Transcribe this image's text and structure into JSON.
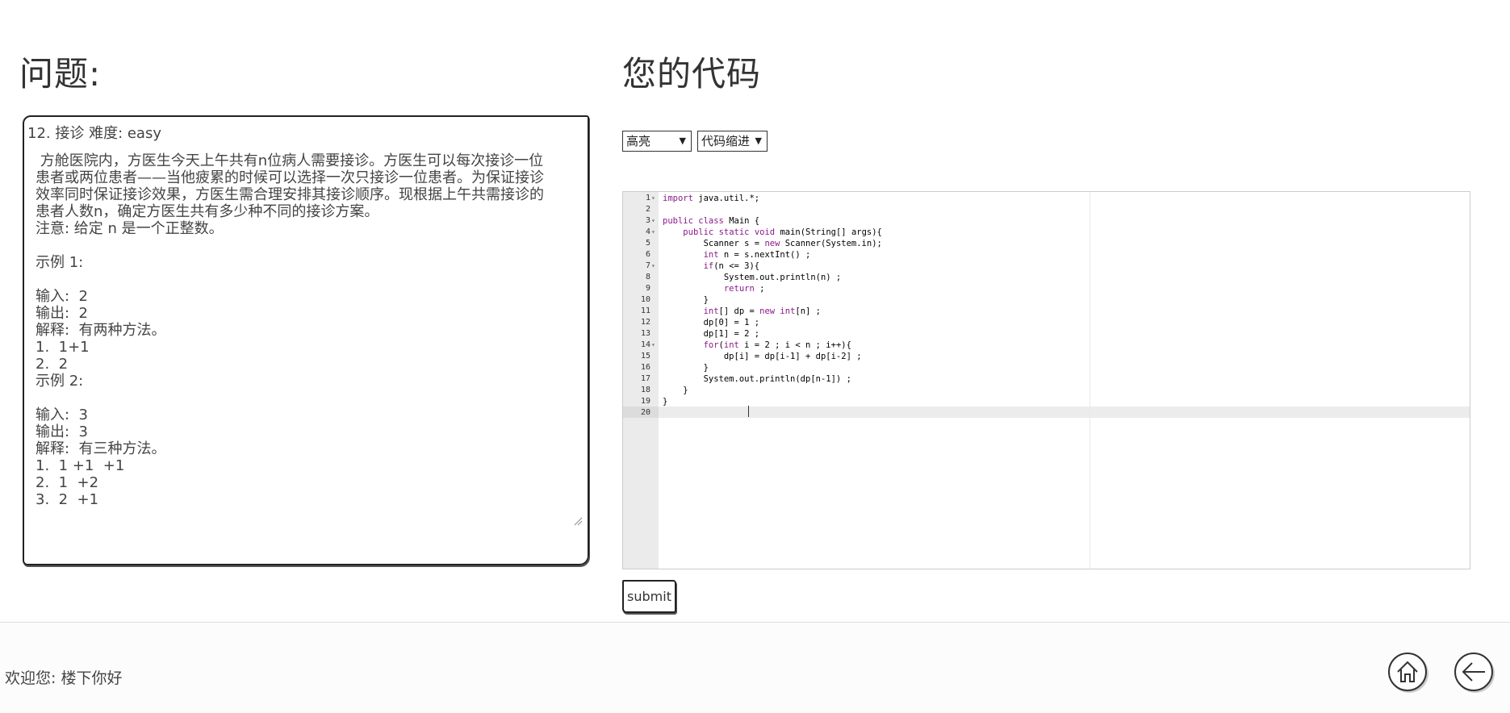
{
  "headings": {
    "question": "问题:",
    "code": "您的代码"
  },
  "problem": {
    "title": "12. 接诊 难度: easy",
    "body": " 方舱医院内，方医生今天上午共有n位病人需要接诊。方医生可以每次接诊一位\n患者或两位患者——当他疲累的时候可以选择一次只接诊一位患者。为保证接诊\n效率同时保证接诊效果，方医生需合理安排其接诊顺序。现根据上午共需接诊的\n患者人数n，确定方医生共有多少种不同的接诊方案。\n注意: 给定 n 是一个正整数。\n\n示例 1:\n\n输入:  2\n输出:  2\n解释:  有两种方法。\n1.  1+1\n2.  2\n示例 2:\n\n输入:  3\n输出:  3\n解释:  有三种方法。\n1.  1 +1  +1\n2.  1  +2\n3.  2  +1"
  },
  "toolbar": {
    "highlight_select": "高亮",
    "indent_select": "代码缩进"
  },
  "editor": {
    "lines": [
      {
        "n": "1",
        "fold": "▾",
        "code": "import java.util.*;"
      },
      {
        "n": "2",
        "fold": "",
        "code": ""
      },
      {
        "n": "3",
        "fold": "▾",
        "code": "public class Main {"
      },
      {
        "n": "4",
        "fold": "▾",
        "code": "    public static void main(String[] args){"
      },
      {
        "n": "5",
        "fold": "",
        "code": "        Scanner s = new Scanner(System.in);"
      },
      {
        "n": "6",
        "fold": "",
        "code": "        int n = s.nextInt() ;"
      },
      {
        "n": "7",
        "fold": "▾",
        "code": "        if(n <= 3){"
      },
      {
        "n": "8",
        "fold": "",
        "code": "            System.out.println(n) ;"
      },
      {
        "n": "9",
        "fold": "",
        "code": "            return ;"
      },
      {
        "n": "10",
        "fold": "",
        "code": "        }"
      },
      {
        "n": "11",
        "fold": "",
        "code": "        int[] dp = new int[n] ;"
      },
      {
        "n": "12",
        "fold": "",
        "code": "        dp[0] = 1 ;"
      },
      {
        "n": "13",
        "fold": "",
        "code": "        dp[1] = 2 ;"
      },
      {
        "n": "14",
        "fold": "▾",
        "code": "        for(int i = 2 ; i < n ; i++){"
      },
      {
        "n": "15",
        "fold": "",
        "code": "            dp[i] = dp[i-1] + dp[i-2] ;"
      },
      {
        "n": "16",
        "fold": "",
        "code": "        }"
      },
      {
        "n": "17",
        "fold": "",
        "code": "        System.out.println(dp[n-1]) ;"
      },
      {
        "n": "18",
        "fold": "",
        "code": "    }"
      },
      {
        "n": "19",
        "fold": "",
        "code": "}"
      },
      {
        "n": "20",
        "fold": "",
        "code": ""
      }
    ]
  },
  "submit_label": "submit",
  "footer": {
    "welcome": "欢迎您: 楼下你好",
    "home_icon": "home-icon",
    "back_icon": "back-arrow-icon"
  },
  "colors": {
    "keyword": "#8a1a8a",
    "gutter": "#ebebeb",
    "active_line": "#ececec"
  }
}
